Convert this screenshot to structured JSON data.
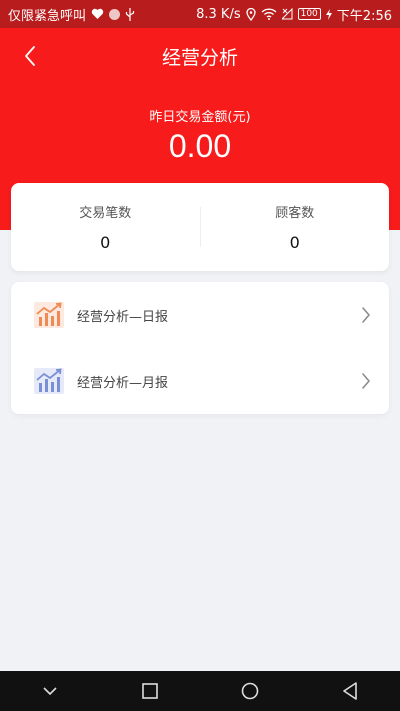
{
  "status_bar": {
    "carrier": "仅限紧急呼叫",
    "speed": "8.3 K/s",
    "battery": "100",
    "time": "下午2:56"
  },
  "header": {
    "title": "经营分析"
  },
  "summary": {
    "amount_label": "昨日交易金额(元)",
    "amount_value": "0.00"
  },
  "stats": [
    {
      "label": "交易笔数",
      "value": "0"
    },
    {
      "label": "顾客数",
      "value": "0"
    }
  ],
  "menu": [
    {
      "label": "经营分析—日报",
      "icon": "bar-chart-icon"
    },
    {
      "label": "经营分析—月报",
      "icon": "bar-chart-icon"
    }
  ],
  "colors": {
    "header_red": "#f71b1b",
    "status_bar": "#b81c1c",
    "daily_icon": "#f08a55",
    "monthly_icon": "#7a8fd6",
    "page_bg": "#f1f2f6"
  }
}
